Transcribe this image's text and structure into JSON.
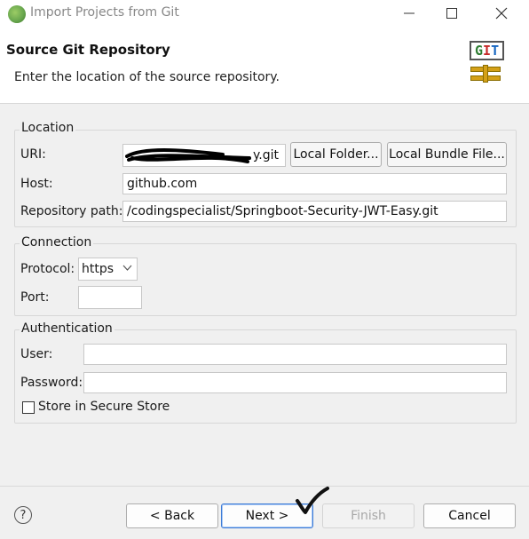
{
  "window": {
    "title": "Import Projects from Git"
  },
  "header": {
    "title": "Source Git Repository",
    "description": "Enter the location of the source repository.",
    "logo_text": [
      "G",
      "I",
      "T"
    ]
  },
  "location": {
    "legend": "Location",
    "uri_label": "URI:",
    "uri_visible_suffix": "y.git",
    "local_folder_button": "Local Folder...",
    "local_bundle_button": "Local Bundle File...",
    "host_label": "Host:",
    "host_value": "github.com",
    "repo_path_label": "Repository path:",
    "repo_path_value": "/codingspecialist/Springboot-Security-JWT-Easy.git"
  },
  "connection": {
    "legend": "Connection",
    "protocol_label": "Protocol:",
    "protocol_value": "https",
    "port_label": "Port:",
    "port_value": ""
  },
  "authentication": {
    "legend": "Authentication",
    "user_label": "User:",
    "user_value": "",
    "password_label": "Password:",
    "password_value": "",
    "store_label": "Store in Secure Store",
    "store_checked": false
  },
  "footer": {
    "help_glyph": "?",
    "back": "< Back",
    "next": "Next >",
    "finish": "Finish",
    "cancel": "Cancel"
  }
}
